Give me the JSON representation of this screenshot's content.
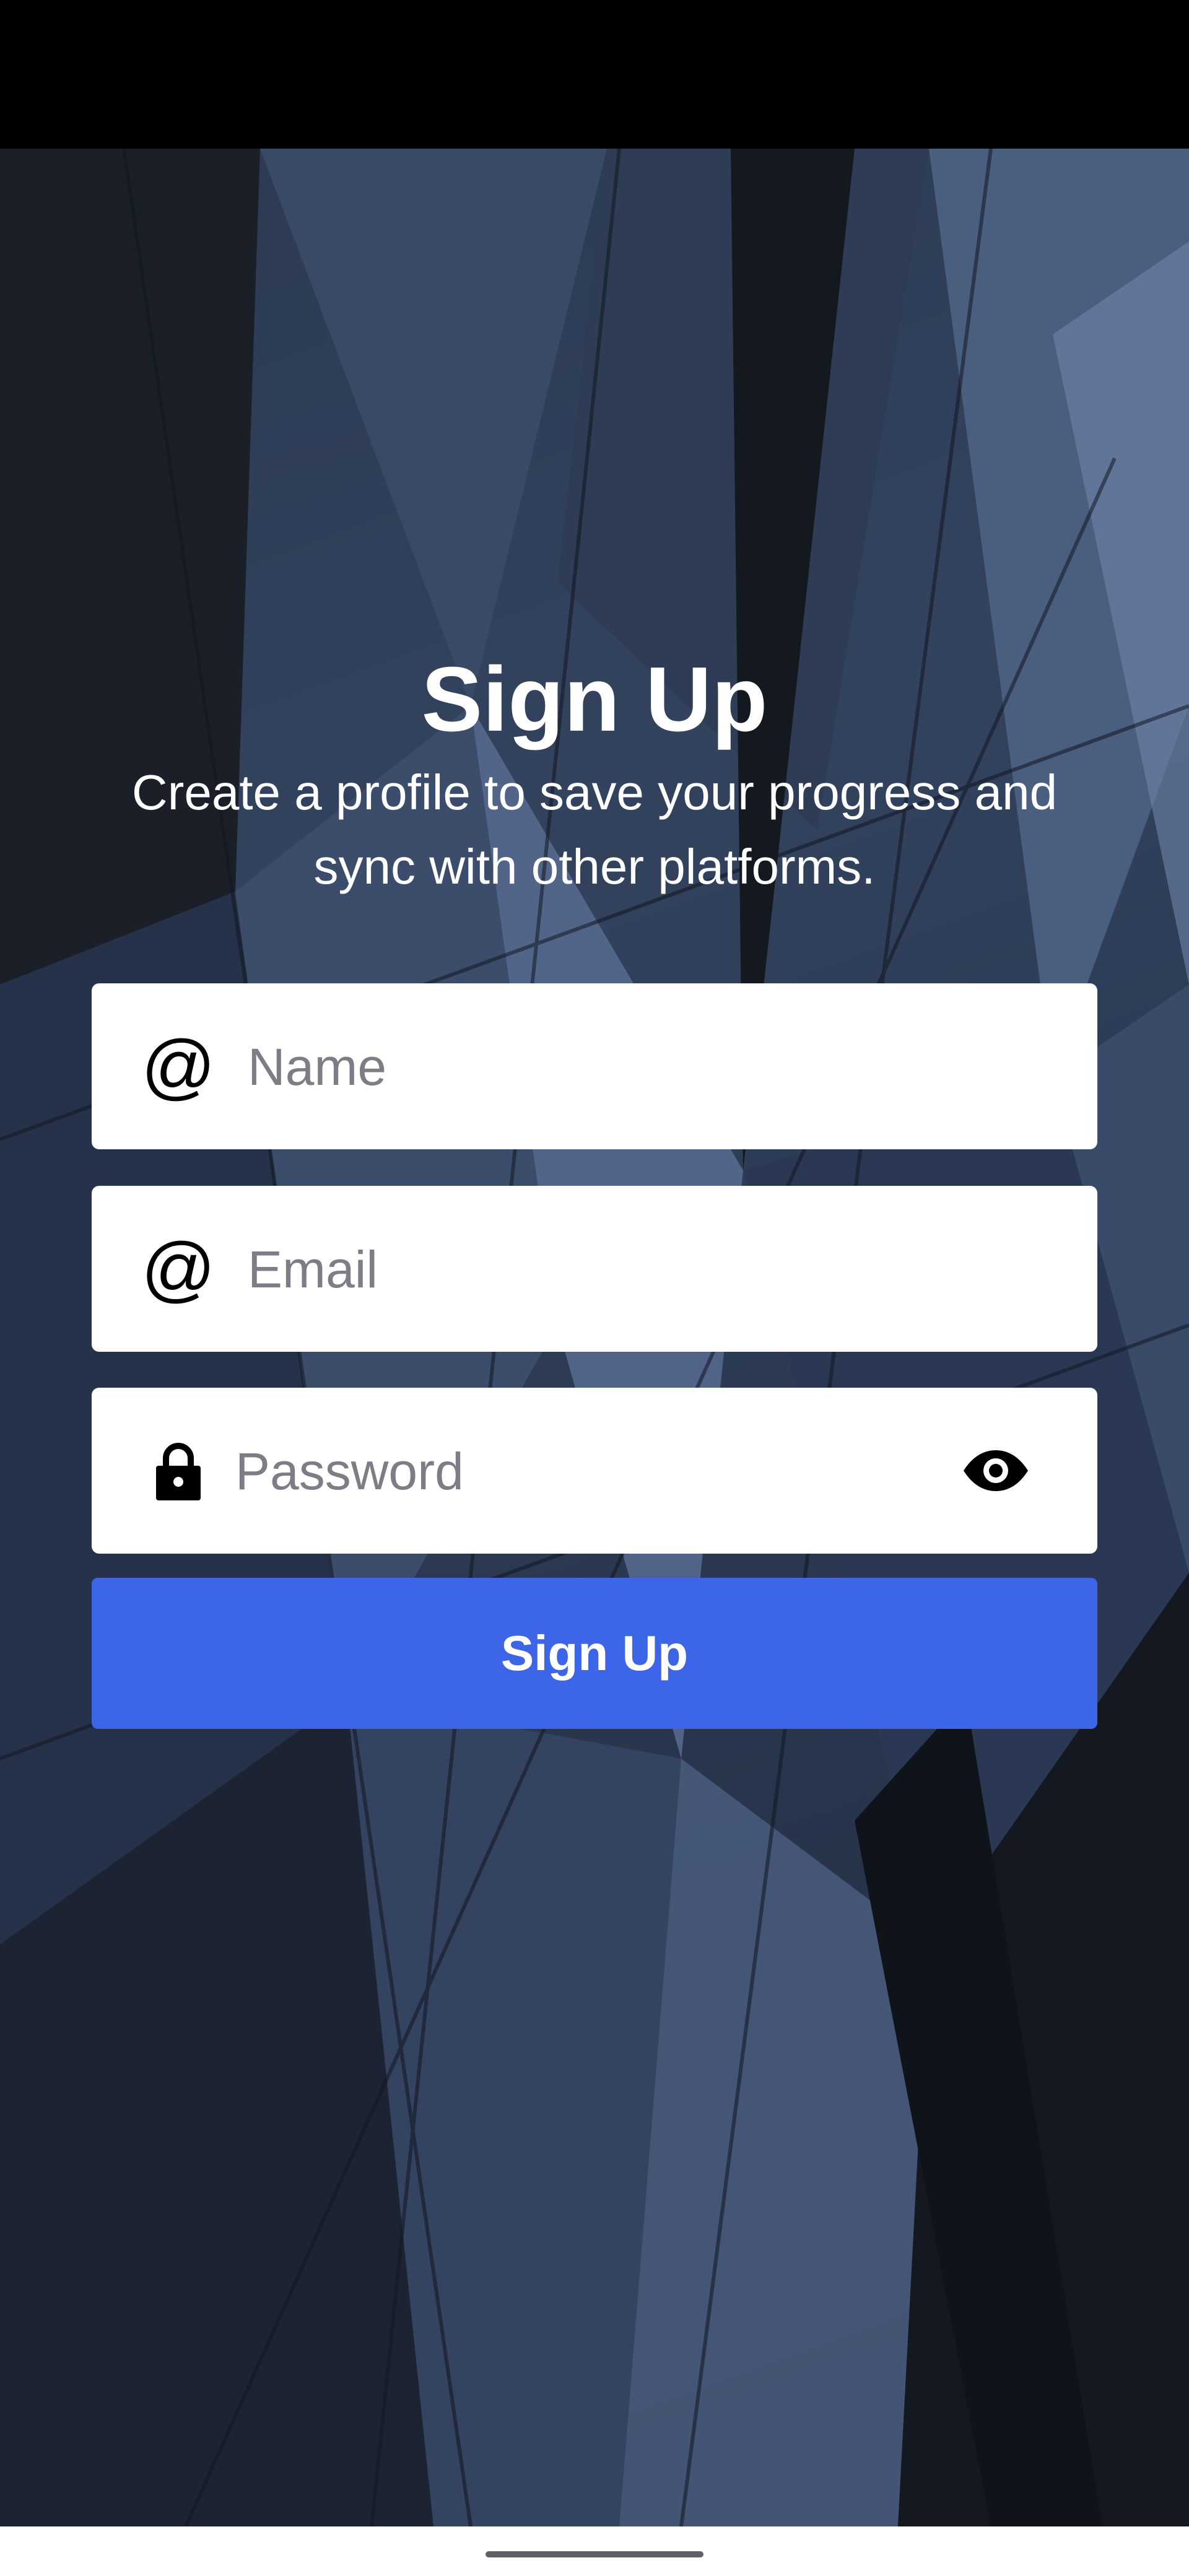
{
  "header": {
    "title": "Sign Up",
    "subtitle": "Create a profile to save your progress and sync with other platforms."
  },
  "form": {
    "name": {
      "placeholder": "Name",
      "value": "",
      "icon": "at-icon"
    },
    "email": {
      "placeholder": "Email",
      "value": "",
      "icon": "at-icon"
    },
    "password": {
      "placeholder": "Password",
      "value": "",
      "icon": "lock-icon",
      "toggle_icon": "eye-icon"
    },
    "submit_label": "Sign Up"
  },
  "colors": {
    "accent": "#3d65e8",
    "field_bg": "#ffffff",
    "text": "#ffffff",
    "placeholder": "#7d7d85"
  }
}
